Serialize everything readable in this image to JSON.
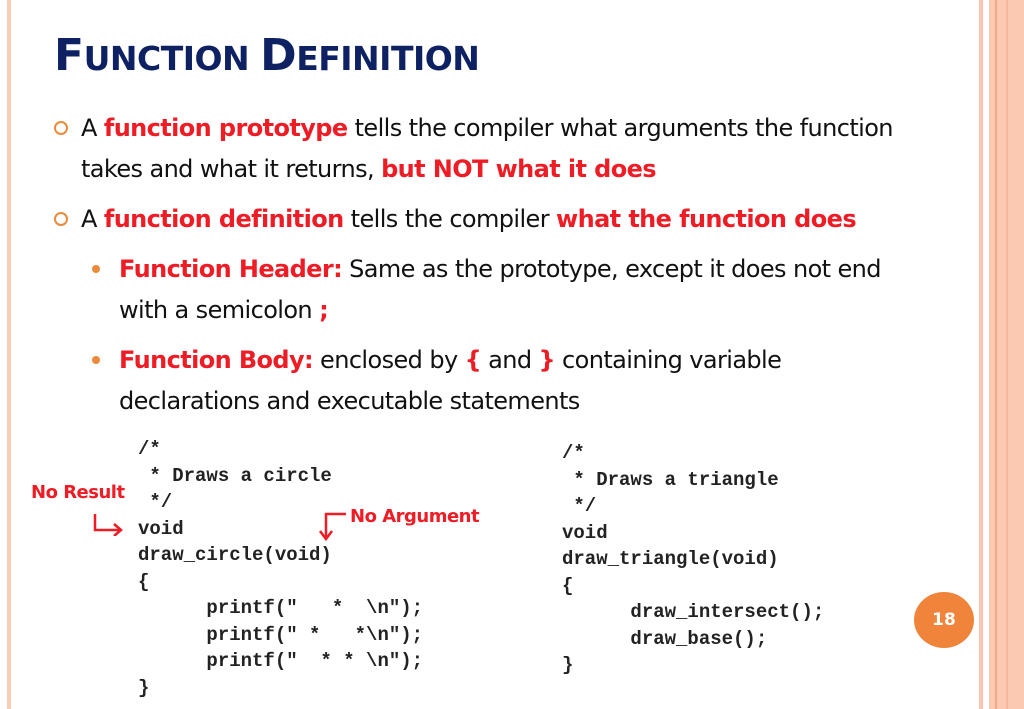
{
  "slide": {
    "title_parts": [
      {
        "cap": "F",
        "rest": "UNCTION "
      },
      {
        "cap": "D",
        "rest": "EFINITION"
      }
    ],
    "bullets": [
      {
        "line1": [
          {
            "text": "A ",
            "style": "normal"
          },
          {
            "text": "function prototype",
            "style": "red"
          },
          {
            "text": " tells the compiler what arguments the function",
            "style": "normal"
          }
        ],
        "line2": [
          {
            "text": "takes and what it returns, ",
            "style": "normal"
          },
          {
            "text": "but NOT what it does",
            "style": "red"
          }
        ]
      },
      {
        "line1": [
          {
            "text": "A ",
            "style": "normal"
          },
          {
            "text": "function definition",
            "style": "red"
          },
          {
            "text": " tells the compiler ",
            "style": "normal"
          },
          {
            "text": "what the function does",
            "style": "red"
          }
        ]
      }
    ],
    "sub_bullets": [
      {
        "line1": [
          {
            "text": "Function Header:",
            "style": "red"
          },
          {
            "text": " Same as the prototype, except it does not end",
            "style": "normal"
          }
        ],
        "line2": [
          {
            "text": "with a semicolon ",
            "style": "normal"
          },
          {
            "text": ";",
            "style": "red"
          }
        ]
      },
      {
        "line1": [
          {
            "text": "Function Body:",
            "style": "red"
          },
          {
            "text": " enclosed by ",
            "style": "normal"
          },
          {
            "text": "{",
            "style": "red"
          },
          {
            "text": " and ",
            "style": "normal"
          },
          {
            "text": "}",
            "style": "red"
          },
          {
            "text": " containing variable",
            "style": "normal"
          }
        ],
        "line2": [
          {
            "text": "declarations and executable statements",
            "style": "normal"
          }
        ]
      }
    ],
    "code_left": "/*\n * Draws a circle\n */\nvoid\ndraw_circle(void)\n{\n      printf(\"   *  \\n\");\n      printf(\" *   *\\n\");\n      printf(\"  * * \\n\");\n}",
    "code_right": "/*\n * Draws a triangle\n */\nvoid\ndraw_triangle(void)\n{\n      draw_intersect();\n      draw_base();\n}",
    "annotations": {
      "no_result": "No Result",
      "no_argument": "No Argument"
    },
    "page_number": "18",
    "colors": {
      "title": "#0e2163",
      "emphasis": "#ee1c25",
      "bullet": "#ec8a3c",
      "badge": "#f0843a",
      "stripe": "#fbc9b2"
    }
  }
}
